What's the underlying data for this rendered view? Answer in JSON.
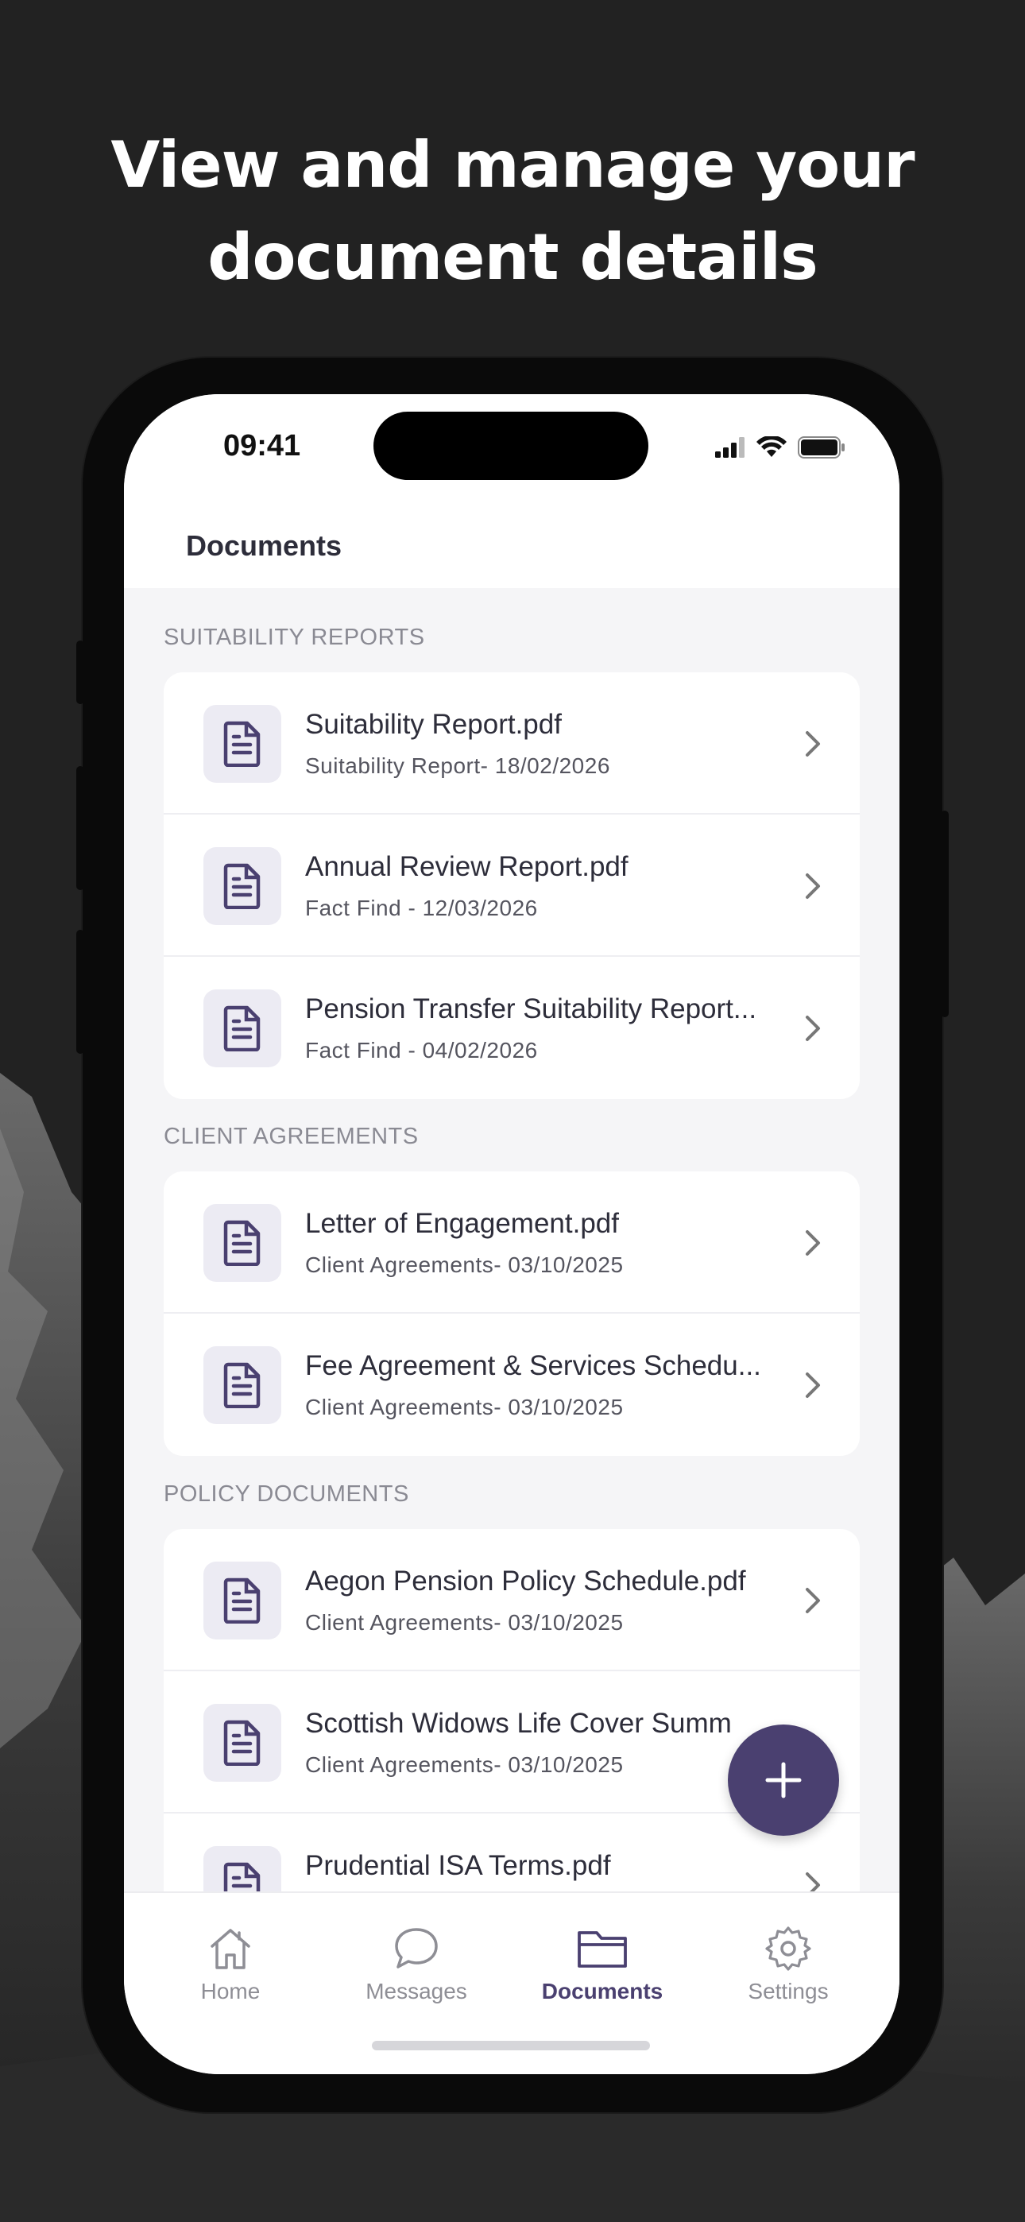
{
  "headline": {
    "line1": "View and manage your",
    "line2": "document details"
  },
  "status_bar": {
    "time": "09:41",
    "icons": [
      "signal-icon",
      "wifi-icon",
      "battery-icon"
    ]
  },
  "header": {
    "title": "Documents"
  },
  "sections": [
    {
      "title": "SUITABILITY REPORTS",
      "items": [
        {
          "title": "Suitability Report.pdf",
          "subtitle": "Suitability Report- 18/02/2026"
        },
        {
          "title": "Annual Review Report.pdf",
          "subtitle": "Fact Find - 12/03/2026"
        },
        {
          "title": "Pension Transfer Suitability Report...",
          "subtitle": "Fact Find - 04/02/2026"
        }
      ]
    },
    {
      "title": "CLIENT AGREEMENTS",
      "items": [
        {
          "title": "Letter of Engagement.pdf",
          "subtitle": "Client Agreements- 03/10/2025"
        },
        {
          "title": "Fee Agreement & Services Schedu...",
          "subtitle": "Client Agreements- 03/10/2025"
        }
      ]
    },
    {
      "title": "POLICY DOCUMENTS",
      "items": [
        {
          "title": "Aegon Pension Policy Schedule.pdf",
          "subtitle": "Client Agreements- 03/10/2025"
        },
        {
          "title": "Scottish Widows Life Cover Summ",
          "subtitle": "Client Agreements- 03/10/2025"
        },
        {
          "title": "Prudential ISA Terms.pdf",
          "subtitle": ""
        }
      ]
    }
  ],
  "fab": {
    "icon": "plus-icon"
  },
  "tabs": [
    {
      "label": "Home",
      "icon": "home-icon",
      "active": false
    },
    {
      "label": "Messages",
      "icon": "chat-bubble-icon",
      "active": false
    },
    {
      "label": "Documents",
      "icon": "folder-icon",
      "active": true
    },
    {
      "label": "Settings",
      "icon": "gear-icon",
      "active": false
    }
  ],
  "colors": {
    "accent": "#4a4070",
    "background": "#222222",
    "screen_bg": "#f5f5f7"
  }
}
